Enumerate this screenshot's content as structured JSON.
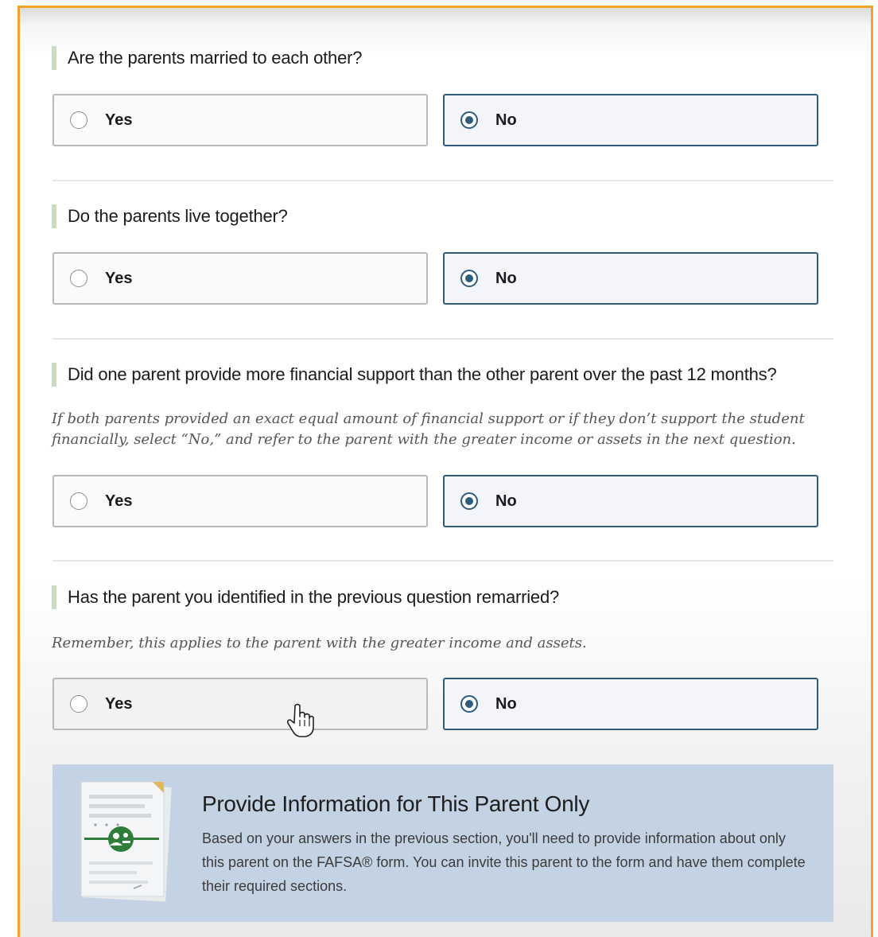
{
  "questions": [
    {
      "text": "Are the parents married to each other?",
      "hint": "",
      "options": {
        "yes": "Yes",
        "no": "No"
      },
      "selected": "No"
    },
    {
      "text": "Do the parents live together?",
      "hint": "",
      "options": {
        "yes": "Yes",
        "no": "No"
      },
      "selected": "No"
    },
    {
      "text": "Did one parent provide more financial support than the other parent over the past 12 months?",
      "hint": "If both parents provided an exact equal amount of financial support or if they don’t support the student financially, select “No,” and refer to the parent with the greater income or assets in the next question.",
      "options": {
        "yes": "Yes",
        "no": "No"
      },
      "selected": "No"
    },
    {
      "text": "Has the parent you identified in the previous question remarried?",
      "hint": "Remember, this applies to the parent with the greater income and assets.",
      "options": {
        "yes": "Yes",
        "no": "No"
      },
      "selected": "No"
    }
  ],
  "info_box": {
    "title": "Provide Information for This Parent Only",
    "body": "Based on your answers in the previous section, you'll need to provide information about only this parent on the FAFSA® form. You can invite this parent to the form and have them complete their required sections.",
    "icon": "document-parent-icon"
  },
  "colors": {
    "frame_border": "#f5a32a",
    "selected_border": "#2f5b7c",
    "info_box_bg": "#c3d3e3",
    "question_marker": "#c9dcc0",
    "icon_green": "#2e7d3a"
  }
}
